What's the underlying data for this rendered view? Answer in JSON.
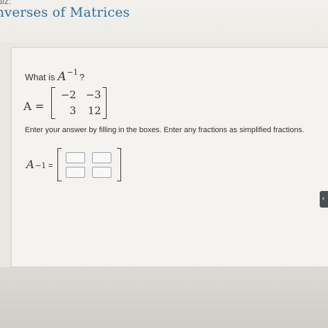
{
  "header": {
    "quiz_label": "uiz:",
    "title": "nverses of Matrices"
  },
  "question": {
    "prompt": "What is",
    "symbol": "A",
    "exponent": "−1",
    "qmark": "?"
  },
  "matrix_a": {
    "label": "A =",
    "cells": [
      [
        "−2",
        "−3"
      ],
      [
        "3",
        "12"
      ]
    ]
  },
  "instruction": "Enter your answer by filling in the boxes. Enter any fractions as simplified fractions.",
  "answer": {
    "symbol": "A",
    "exponent": "−1",
    "equals": "=",
    "inputs": [
      "",
      "",
      "",
      ""
    ]
  },
  "side_tab_icon": "chevron-left-icon",
  "side_tab_glyph": "‹"
}
